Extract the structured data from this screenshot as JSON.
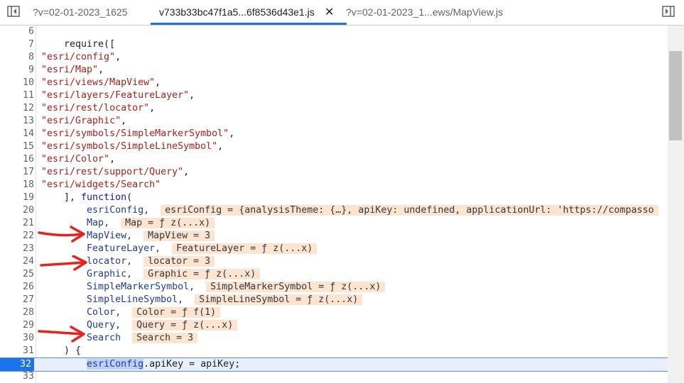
{
  "tabs": [
    {
      "label": "?v=02-01-2023_1625"
    },
    {
      "label": "v733b33bc47f1a5...6f8536d43e1.js",
      "close": "✕"
    },
    {
      "label": "?v=02-01-2023_1...ews/MapView.js"
    }
  ],
  "lines": [
    {
      "n": "6",
      "code": ""
    },
    {
      "n": "7",
      "code": "    require(["
    },
    {
      "n": "8",
      "code": "\"esri/config\","
    },
    {
      "n": "9",
      "code": "\"esri/Map\","
    },
    {
      "n": "10",
      "code": "\"esri/views/MapView\","
    },
    {
      "n": "11",
      "code": "\"esri/layers/FeatureLayer\","
    },
    {
      "n": "12",
      "code": "\"esri/rest/locator\","
    },
    {
      "n": "13",
      "code": "\"esri/Graphic\","
    },
    {
      "n": "14",
      "code": "\"esri/symbols/SimpleMarkerSymbol\","
    },
    {
      "n": "15",
      "code": "\"esri/symbols/SimpleLineSymbol\","
    },
    {
      "n": "16",
      "code": "\"esri/Color\","
    },
    {
      "n": "17",
      "code": "\"esri/rest/support/Query\","
    },
    {
      "n": "18",
      "code": "\"esri/widgets/Search\""
    },
    {
      "n": "19",
      "pre": "    ], ",
      "kw": "function",
      "post": "("
    },
    {
      "n": "20",
      "id": "esriConfig,",
      "inline": "esriConfig = {analysisTheme: {…}, apiKey: undefined, applicationUrl: 'https://compasso"
    },
    {
      "n": "21",
      "id": "Map,",
      "inline": "Map = ƒ z(...x)"
    },
    {
      "n": "22",
      "id": "MapView,",
      "inline": "MapView = 3"
    },
    {
      "n": "23",
      "id": "FeatureLayer,",
      "inline": "FeatureLayer = ƒ z(...x)"
    },
    {
      "n": "24",
      "id": "locator,",
      "inline": "locator = 3"
    },
    {
      "n": "25",
      "id": "Graphic,",
      "inline": "Graphic = ƒ z(...x)"
    },
    {
      "n": "26",
      "id": "SimpleMarkerSymbol,",
      "inline": "SimpleMarkerSymbol = ƒ z(...x)"
    },
    {
      "n": "27",
      "id": "SimpleLineSymbol,",
      "inline": "SimpleLineSymbol = ƒ z(...x)"
    },
    {
      "n": "28",
      "id": "Color,",
      "inline": "Color = ƒ f(1)"
    },
    {
      "n": "29",
      "id": "Query,",
      "inline": "Query = ƒ z(...x)"
    },
    {
      "n": "30",
      "id": "Search",
      "inline": "Search = 3"
    },
    {
      "n": "31",
      "code": "    ) {"
    },
    {
      "n": "32",
      "sel": "esriConfig",
      "rest": ".apiKey = apiKey;"
    },
    {
      "n": "33",
      "code": ""
    }
  ],
  "colors": {
    "exec_line": "#1a73e8",
    "annotation_arrow": "#e8221b",
    "inline_value_bg": "#fde4cf"
  }
}
